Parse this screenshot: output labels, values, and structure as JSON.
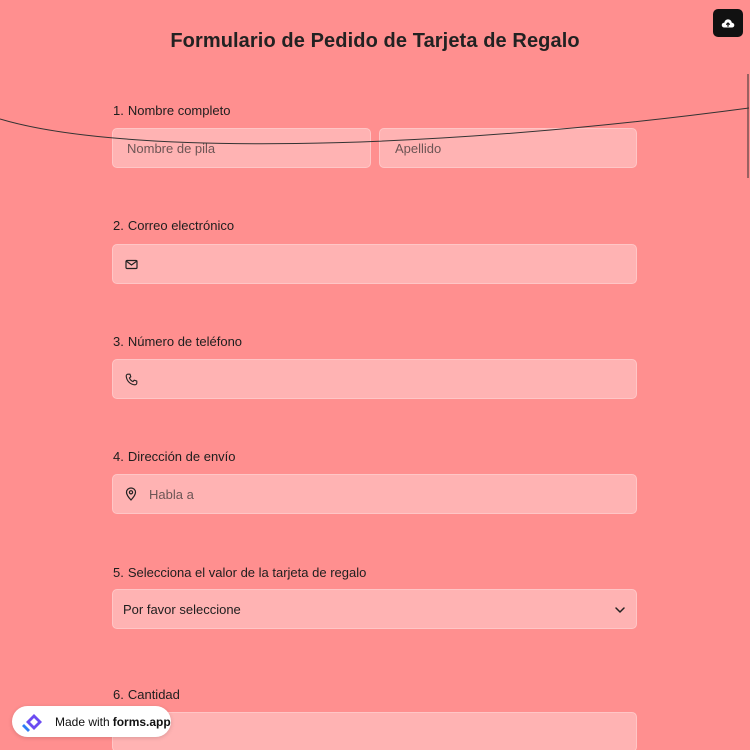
{
  "header": {
    "title": "Formulario de Pedido de Tarjeta de Regalo"
  },
  "toolbar": {
    "upload_icon": "cloud-upload-icon"
  },
  "questions": [
    {
      "number": "1.",
      "label": "Nombre completo",
      "first_placeholder": "Nombre de pila",
      "last_placeholder": "Apellido"
    },
    {
      "number": "2.",
      "label": "Correo electrónico",
      "icon": "mail-icon",
      "placeholder": ""
    },
    {
      "number": "3.",
      "label": "Número de teléfono",
      "icon": "phone-icon",
      "placeholder": ""
    },
    {
      "number": "4.",
      "label": "Dirección de envío",
      "icon": "location-pin-icon",
      "placeholder": "Habla a"
    },
    {
      "number": "5.",
      "label": "Selecciona el valor de la tarjeta de regalo",
      "selected": "Por favor seleccione",
      "icon": "chevron-down-icon"
    },
    {
      "number": "6.",
      "label": "Cantidad"
    }
  ],
  "badge": {
    "prefix": "Made with",
    "brand": "forms.app"
  },
  "colors": {
    "background": "#ff8f8f",
    "field": "#ffb3b3",
    "text": "#1e1e1e"
  }
}
